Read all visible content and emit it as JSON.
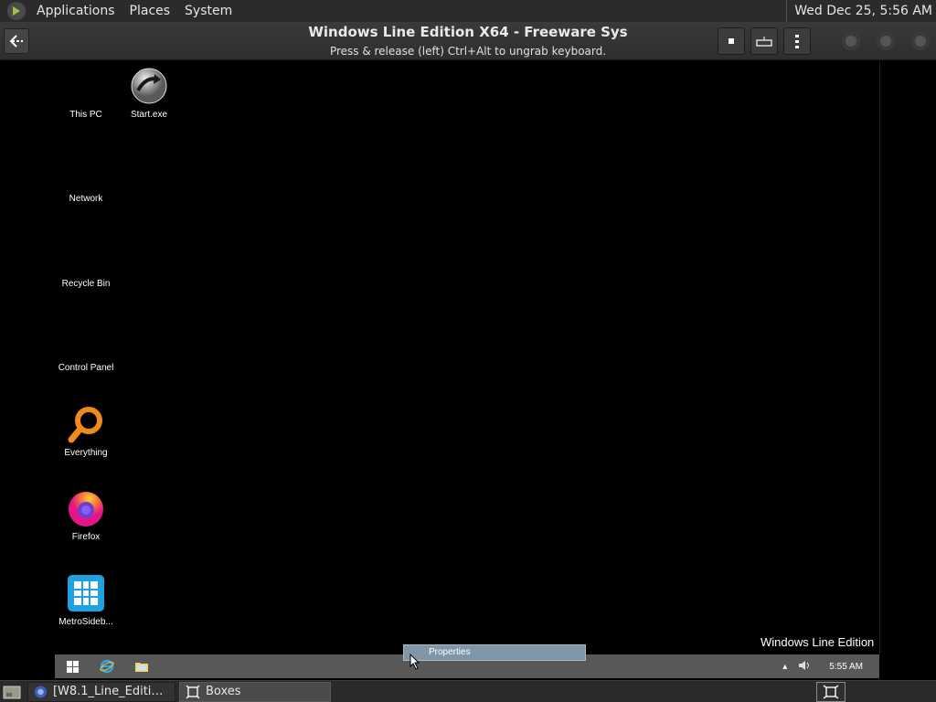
{
  "host_panel": {
    "menus": [
      "Applications",
      "Places",
      "System"
    ],
    "clock": "Wed Dec 25,  5:56 AM"
  },
  "boxes": {
    "title": "Windows Line Edition X64 - Freeware Sys",
    "subtitle": "Press & release (left) Ctrl+Alt to ungrab keyboard."
  },
  "guest": {
    "desktop_icons": [
      {
        "label": "This PC",
        "icon": "this-pc-icon"
      },
      {
        "label": "Start.exe",
        "icon": "start-exe-icon"
      },
      {
        "label": "Network",
        "icon": "network-icon"
      },
      {
        "label": "Recycle Bin",
        "icon": "recycle-bin-icon"
      },
      {
        "label": "Control Panel",
        "icon": "control-panel-icon"
      },
      {
        "label": "Everything",
        "icon": "everything-search-icon"
      },
      {
        "label": "Firefox",
        "icon": "firefox-icon"
      },
      {
        "label": "MetroSideb...",
        "icon": "metro-sidebar-icon"
      }
    ],
    "watermark": "Windows Line Edition",
    "context_item": "Properties",
    "taskbar": {
      "tray_clock": "5:55 AM"
    }
  },
  "host_taskbar": {
    "tasks": [
      {
        "label": "[W8.1_Line_Edition...",
        "icon": "browser-icon"
      },
      {
        "label": "Boxes",
        "icon": "boxes-icon"
      }
    ]
  },
  "colors": {
    "accent_blue": "#1fa3e0",
    "firefox_orange": "#ff7139",
    "everything_orange": "#f08a1c"
  }
}
